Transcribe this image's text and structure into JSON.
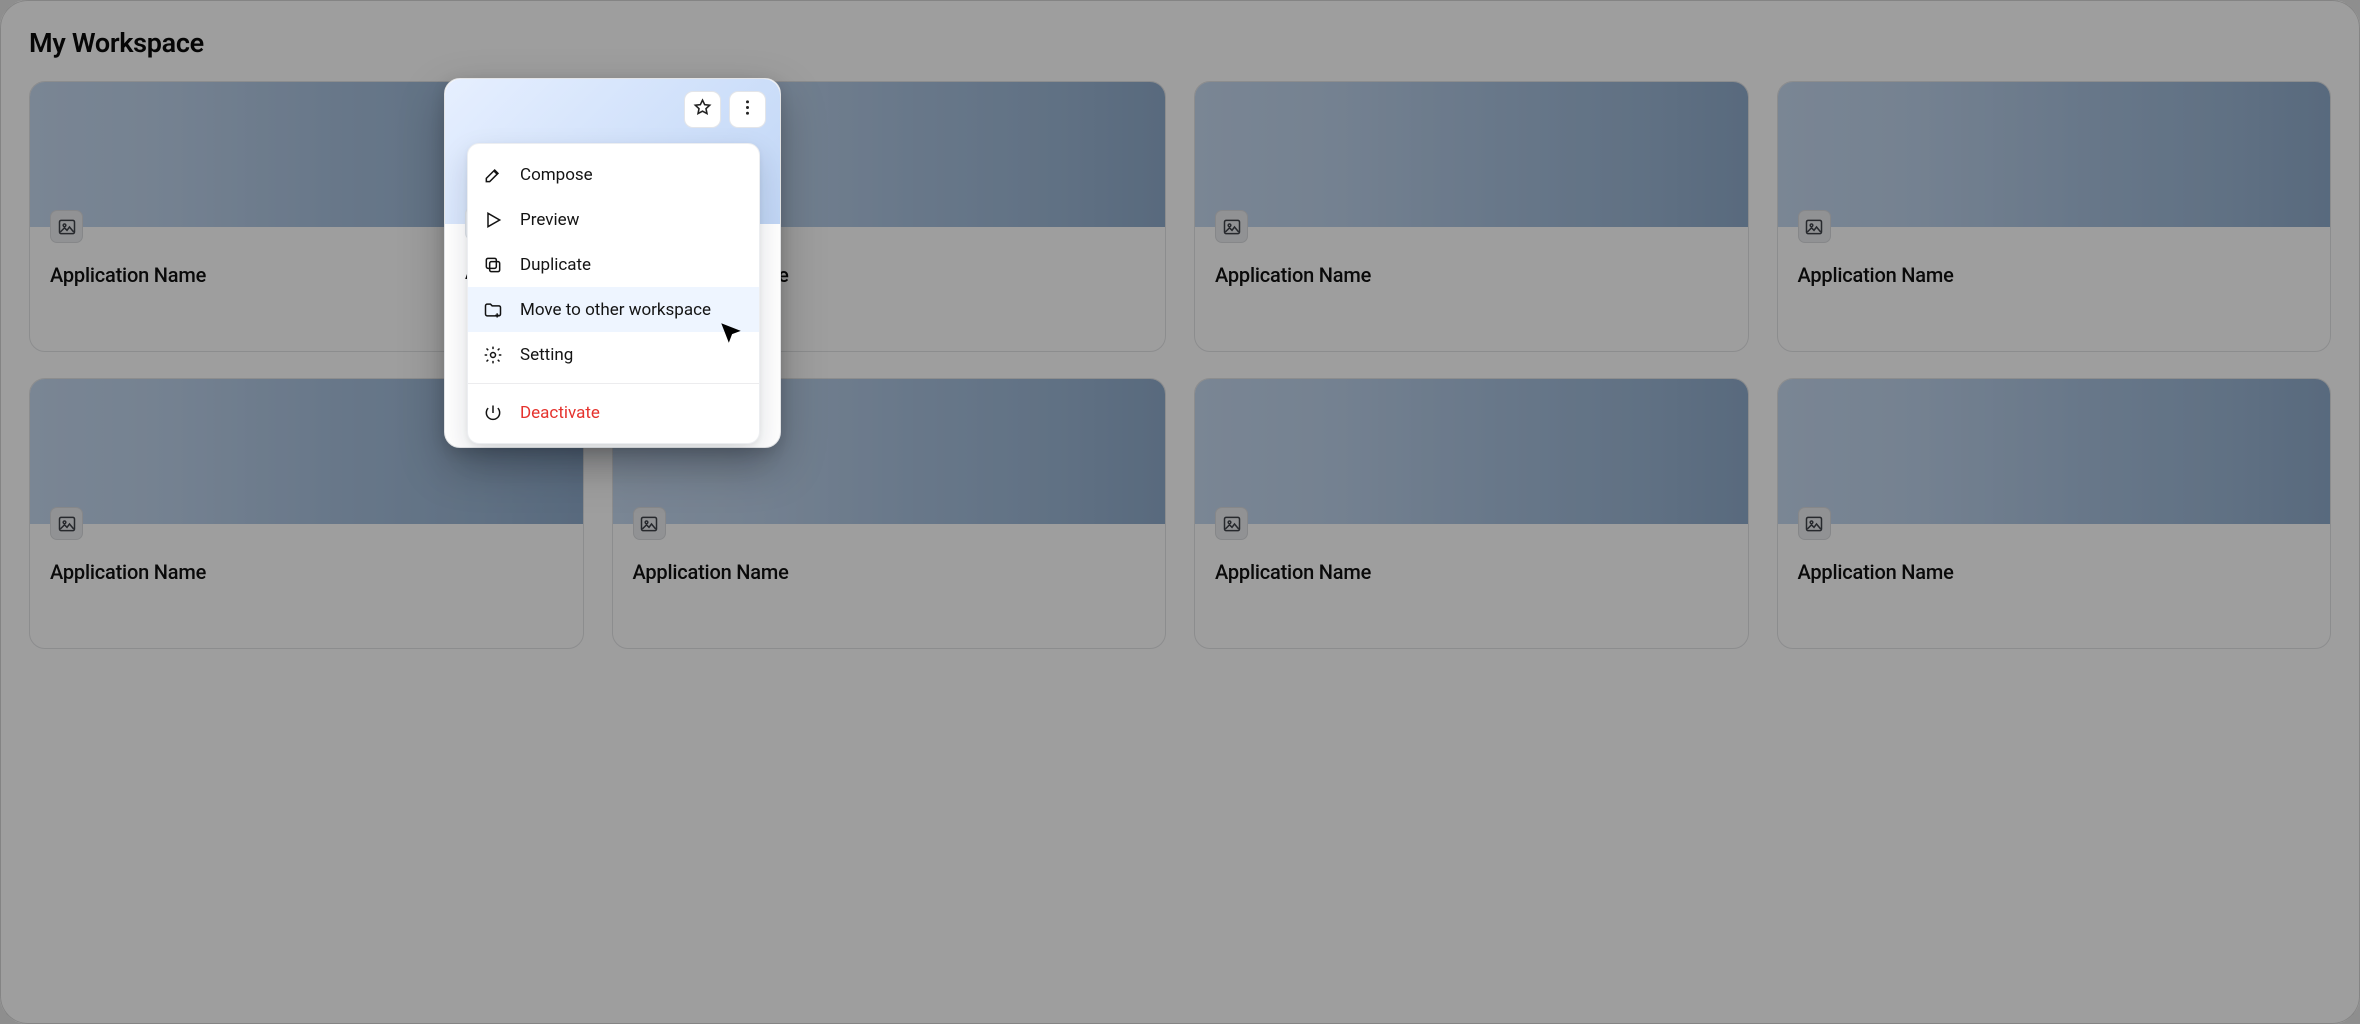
{
  "workspace": {
    "title": "My Workspace"
  },
  "cards": [
    {
      "name": "Application Name"
    },
    {
      "name": "Application Name"
    },
    {
      "name": "Application Name"
    },
    {
      "name": "Application Name"
    },
    {
      "name": "Application Name"
    },
    {
      "name": "Application Name"
    },
    {
      "name": "Application Name"
    },
    {
      "name": "Application Name"
    }
  ],
  "focused_card": {
    "name_prefix": "App"
  },
  "menu": {
    "compose": "Compose",
    "preview": "Preview",
    "duplicate": "Duplicate",
    "move": "Move to other workspace",
    "setting": "Setting",
    "deactivate": "Deactivate"
  }
}
